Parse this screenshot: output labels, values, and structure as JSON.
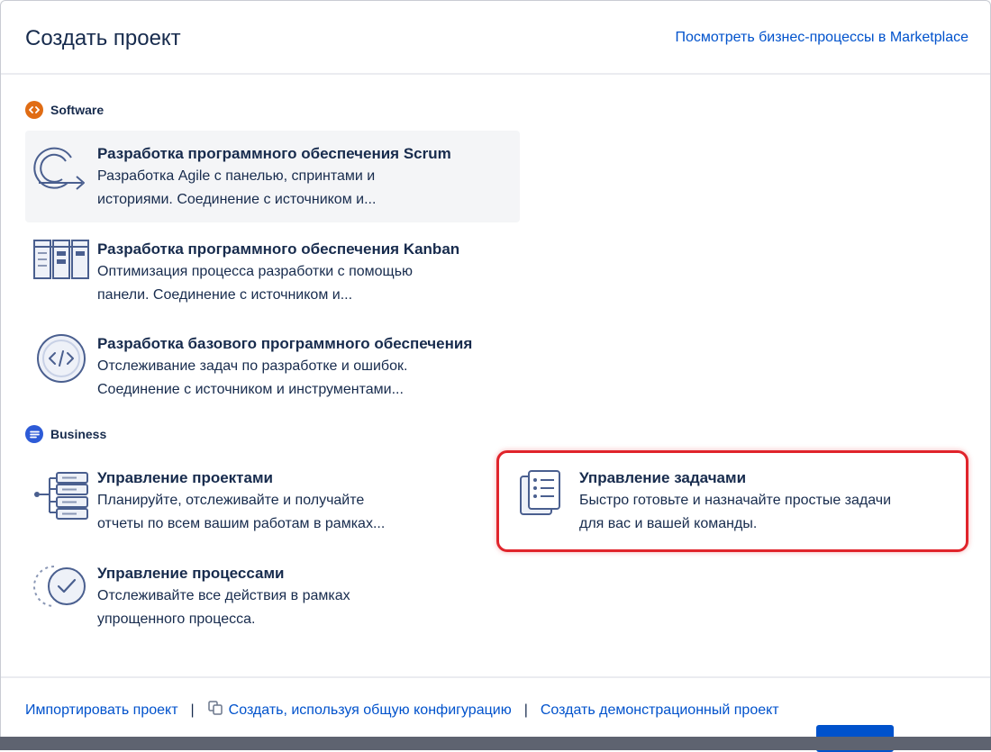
{
  "header": {
    "title": "Создать проект",
    "marketplace_link": "Посмотреть бизнес-процессы в Marketplace"
  },
  "sections": {
    "software": {
      "label": "Software",
      "icon": "code-brackets-icon",
      "color": "#e06c14",
      "items": [
        {
          "name": "Разработка программного обеспечения Scrum",
          "desc1": "Разработка Agile с панелью, спринтами и",
          "desc2": "историями. Соединение с источником и...",
          "icon": "scrum-cycle-icon",
          "selected": true
        },
        {
          "name": "Разработка программного обеспечения Kanban",
          "desc1": "Оптимизация процесса разработки с помощью",
          "desc2": "панели. Соединение с источником и...",
          "icon": "kanban-board-icon"
        },
        {
          "name": "Разработка базового программного обеспечения",
          "desc1": "Отслеживание задач по разработке и ошибок.",
          "desc2": "Соединение с источником и инструментами...",
          "icon": "code-circle-icon"
        }
      ]
    },
    "business": {
      "label": "Business",
      "icon": "document-lines-icon",
      "color": "#2d5bd7",
      "items": [
        {
          "name": "Управление проектами",
          "desc1": "Планируйте, отслеживайте и получайте",
          "desc2": "отчеты по всем вашим работам в рамках...",
          "icon": "project-tree-icon"
        },
        {
          "name": "Управление задачами",
          "desc1": "Быстро готовьте и назначайте простые задачи",
          "desc2": "для вас и вашей команды.",
          "icon": "task-list-icon",
          "highlighted": true
        },
        {
          "name": "Управление процессами",
          "desc1": "Отслеживайте все действия в рамках",
          "desc2": "упрощенного процесса.",
          "icon": "process-check-icon"
        }
      ]
    }
  },
  "footer": {
    "import": "Импортировать проект",
    "shared_config": "Создать, используя общую конфигурацию",
    "demo": "Создать демонстрационный проект",
    "separator": "|"
  },
  "colors": {
    "link": "#0052cc",
    "text": "#172b4d",
    "highlight": "#e0242b",
    "selected_bg": "#f4f5f7",
    "icon_stroke": "#4a5f8f"
  }
}
